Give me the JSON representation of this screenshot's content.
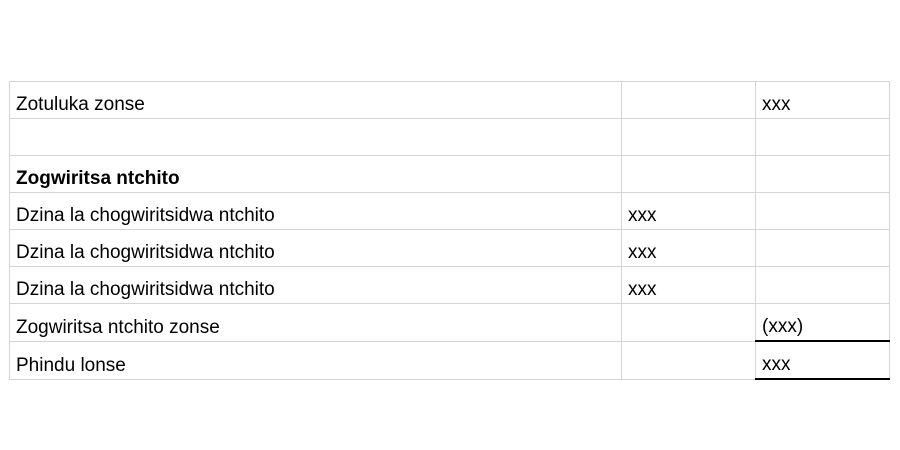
{
  "rows": [
    {
      "label": "Zotuluka zonse",
      "col2": "",
      "col3": "xxx"
    },
    {
      "label": "",
      "col2": "",
      "col3": ""
    },
    {
      "label": "Zogwiritsa ntchito",
      "col2": "",
      "col3": ""
    },
    {
      "label": "Dzina la chogwiritsidwa ntchito",
      "col2": "xxx",
      "col3": ""
    },
    {
      "label": "Dzina la chogwiritsidwa ntchito",
      "col2": "xxx",
      "col3": ""
    },
    {
      "label": "Dzina la chogwiritsidwa ntchito",
      "col2": "xxx",
      "col3": ""
    },
    {
      "label": "Zogwiritsa ntchito zonse",
      "col2": "",
      "col3": "(xxx)"
    },
    {
      "label": "Phindu lonse",
      "col2": "",
      "col3": "xxx"
    }
  ]
}
